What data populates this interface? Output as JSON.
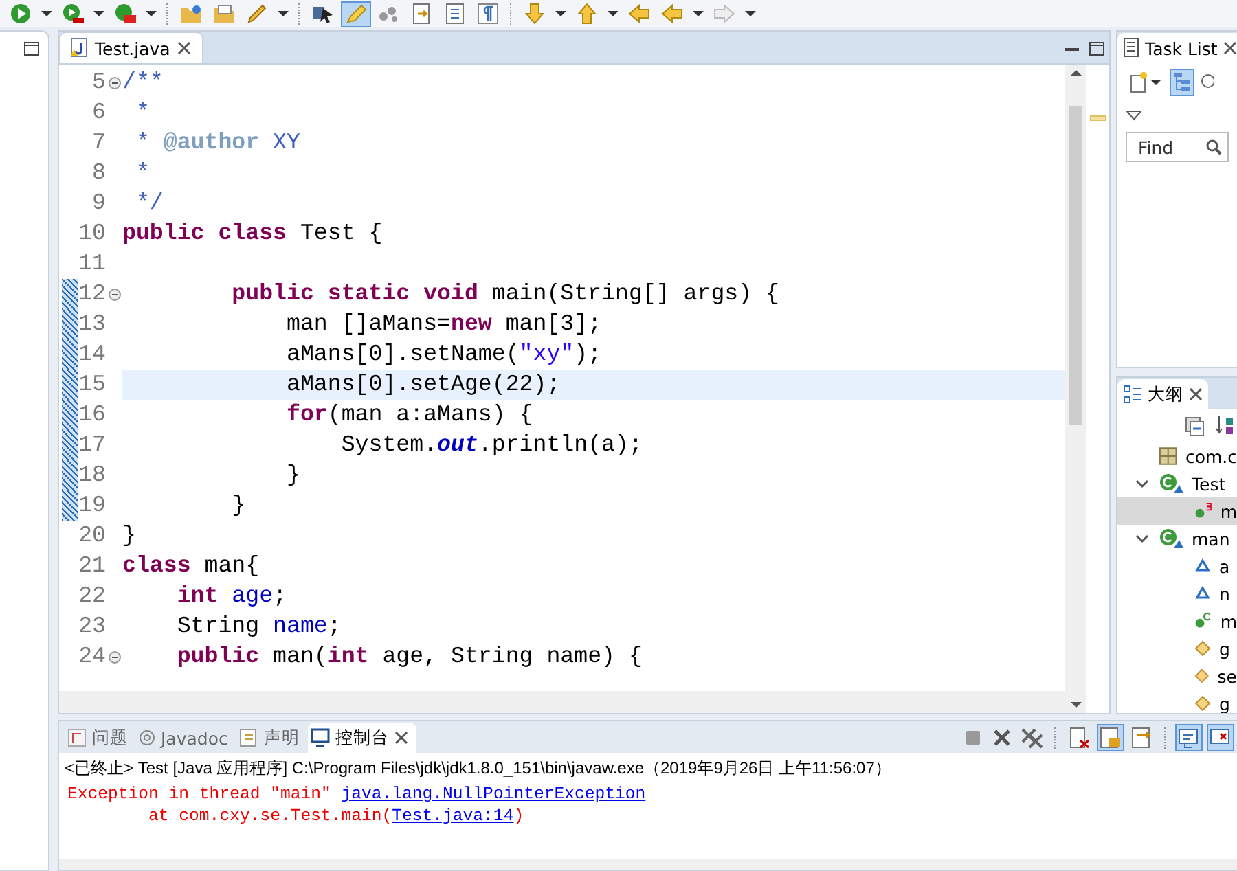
{
  "toolbar": [
    {
      "kind": "run",
      "selected": false
    },
    {
      "kind": "caret",
      "selected": false
    },
    {
      "kind": "debug",
      "selected": false
    },
    {
      "kind": "caret",
      "selected": false
    },
    {
      "kind": "toolbox",
      "selected": false
    },
    {
      "kind": "caret",
      "selected": false
    },
    {
      "kind": "separator"
    },
    {
      "kind": "folder-open",
      "selected": false
    },
    {
      "kind": "folder",
      "selected": false
    },
    {
      "kind": "pen",
      "selected": false
    },
    {
      "kind": "caret",
      "selected": false
    },
    {
      "kind": "separator"
    },
    {
      "kind": "cursor",
      "selected": false
    },
    {
      "kind": "highlighter",
      "selected": true
    },
    {
      "kind": "dots",
      "selected": false
    },
    {
      "kind": "doc-arrow",
      "selected": false
    },
    {
      "kind": "doc-list",
      "selected": false
    },
    {
      "kind": "pilcrow",
      "selected": false
    },
    {
      "kind": "separator"
    },
    {
      "kind": "down",
      "selected": false
    },
    {
      "kind": "caret",
      "selected": false
    },
    {
      "kind": "up",
      "selected": false
    },
    {
      "kind": "caret",
      "selected": false
    },
    {
      "kind": "back",
      "selected": false
    },
    {
      "kind": "left",
      "selected": false
    },
    {
      "kind": "caret",
      "selected": false
    },
    {
      "kind": "right",
      "selected": false
    },
    {
      "kind": "caret",
      "selected": false
    }
  ],
  "editor": {
    "tab": {
      "title": "Test.java"
    },
    "lines": [
      {
        "number": "5",
        "fold": true,
        "changed": false,
        "current": false,
        "tokens": [
          {
            "kind": "comment",
            "text": "/**"
          }
        ]
      },
      {
        "number": "6",
        "fold": false,
        "changed": false,
        "current": false,
        "tokens": [
          {
            "kind": "comment",
            "text": " *"
          }
        ]
      },
      {
        "number": "7",
        "fold": false,
        "changed": false,
        "current": false,
        "tokens": [
          {
            "kind": "comment",
            "text": " * "
          },
          {
            "kind": "tag",
            "text": "@author"
          },
          {
            "kind": "comment",
            "text": " XY"
          }
        ]
      },
      {
        "number": "8",
        "fold": false,
        "changed": false,
        "current": false,
        "tokens": [
          {
            "kind": "comment",
            "text": " *"
          }
        ]
      },
      {
        "number": "9",
        "fold": false,
        "changed": false,
        "current": false,
        "tokens": [
          {
            "kind": "comment",
            "text": " */"
          }
        ]
      },
      {
        "number": "10",
        "fold": false,
        "changed": false,
        "current": false,
        "tokens": [
          {
            "kind": "keyword",
            "text": "public class"
          },
          {
            "kind": "plain",
            "text": " Test {"
          }
        ]
      },
      {
        "number": "11",
        "fold": false,
        "changed": false,
        "current": false
      },
      {
        "number": "12",
        "fold": true,
        "changed": true,
        "current": false,
        "tokens": [
          {
            "kind": "keyword",
            "text": "        public static void"
          },
          {
            "kind": "plain",
            "text": " main(String[] args) {"
          }
        ]
      },
      {
        "number": "13",
        "fold": false,
        "changed": true,
        "current": false,
        "tokens": [
          {
            "kind": "plain",
            "text": "            man []aMans="
          },
          {
            "kind": "keyword",
            "text": "new"
          },
          {
            "kind": "plain",
            "text": " man[3];"
          }
        ]
      },
      {
        "number": "14",
        "fold": false,
        "changed": true,
        "current": false,
        "tokens": [
          {
            "kind": "plain",
            "text": "            aMans[0].setName("
          },
          {
            "kind": "string",
            "text": "\"xy\""
          },
          {
            "kind": "plain",
            "text": ");"
          }
        ]
      },
      {
        "number": "15",
        "fold": false,
        "changed": true,
        "current": true,
        "tokens": [
          {
            "kind": "plain",
            "text": "            aMans[0].setAge(22);"
          }
        ]
      },
      {
        "number": "16",
        "fold": false,
        "changed": true,
        "current": false,
        "tokens": [
          {
            "kind": "keyword",
            "text": "            for"
          },
          {
            "kind": "plain",
            "text": "(man a:aMans) {"
          }
        ]
      },
      {
        "number": "17",
        "fold": false,
        "changed": true,
        "current": false,
        "tokens": [
          {
            "kind": "plain",
            "text": "                System."
          },
          {
            "kind": "static",
            "text": "out"
          },
          {
            "kind": "plain",
            "text": ".println(a);"
          }
        ]
      },
      {
        "number": "18",
        "fold": false,
        "changed": true,
        "current": false,
        "tokens": [
          {
            "kind": "plain",
            "text": "            }"
          }
        ]
      },
      {
        "number": "19",
        "fold": false,
        "changed": true,
        "current": false,
        "tokens": [
          {
            "kind": "plain",
            "text": "        }"
          }
        ]
      },
      {
        "number": "20",
        "fold": false,
        "changed": false,
        "current": false,
        "tokens": [
          {
            "kind": "plain",
            "text": "}"
          }
        ]
      },
      {
        "number": "21",
        "fold": false,
        "changed": false,
        "current": false,
        "tokens": [
          {
            "kind": "keyword",
            "text": "class"
          },
          {
            "kind": "plain",
            "text": " man{"
          }
        ]
      },
      {
        "number": "22",
        "fold": false,
        "changed": false,
        "current": false,
        "tokens": [
          {
            "kind": "keyword",
            "text": "    int"
          },
          {
            "kind": "field",
            "text": " age"
          },
          {
            "kind": "plain",
            "text": ";"
          }
        ]
      },
      {
        "number": "23",
        "fold": false,
        "changed": false,
        "current": false,
        "tokens": [
          {
            "kind": "plain",
            "text": "    String "
          },
          {
            "kind": "field",
            "text": "name"
          },
          {
            "kind": "plain",
            "text": ";"
          }
        ]
      },
      {
        "number": "24",
        "fold": true,
        "changed": false,
        "current": false,
        "tokens": [
          {
            "kind": "keyword",
            "text": "    public"
          },
          {
            "kind": "plain",
            "text": " man("
          },
          {
            "kind": "keyword",
            "text": "int"
          },
          {
            "kind": "plain",
            "text": " age, String name) {"
          }
        ]
      }
    ]
  },
  "task_list": {
    "title": "Task List",
    "search": {
      "placeholder": "Find"
    }
  },
  "outline": {
    "title": "大纲",
    "items": [
      {
        "label": "com.c",
        "kind": "imports",
        "selected": false
      },
      {
        "label": "Test",
        "kind": "class",
        "selected": false,
        "expanded": true,
        "children": [
          {
            "label": "m",
            "kind": "static-method",
            "selected": true
          }
        ]
      },
      {
        "label": "man",
        "kind": "class",
        "selected": false,
        "expanded": true,
        "children": [
          {
            "label": "a",
            "kind": "field",
            "selected": false
          },
          {
            "label": "n",
            "kind": "field",
            "selected": false
          },
          {
            "label": "m",
            "kind": "constructor",
            "selected": false
          },
          {
            "label": "g",
            "kind": "method",
            "selected": false
          },
          {
            "label": "se",
            "kind": "method",
            "selected": false
          },
          {
            "label": "g",
            "kind": "method",
            "selected": false
          }
        ]
      }
    ]
  },
  "console": {
    "tabs": [
      {
        "label": "问题",
        "kind": "problems",
        "selected": false
      },
      {
        "label": "Javadoc",
        "kind": "javadoc",
        "selected": false
      },
      {
        "label": "声明",
        "kind": "declaration",
        "selected": false
      },
      {
        "label": "控制台",
        "kind": "console",
        "selected": true
      }
    ],
    "toolbar": [
      {
        "kind": "stop",
        "selected": false
      },
      {
        "kind": "remove",
        "selected": false
      },
      {
        "kind": "remove-all",
        "selected": false
      },
      {
        "kind": "separator"
      },
      {
        "kind": "clear",
        "selected": false
      },
      {
        "kind": "scroll-lock",
        "selected": true
      },
      {
        "kind": "word-wrap",
        "selected": false
      },
      {
        "kind": "separator"
      },
      {
        "kind": "pin",
        "selected": true
      },
      {
        "kind": "display",
        "selected": true
      }
    ],
    "header": "<已终止> Test [Java 应用程序] C:\\Program Files\\jdk\\jdk1.8.0_151\\bin\\javaw.exe（2019年9月26日 上午11:56:07）",
    "output": [
      [
        {
          "kind": "text",
          "text": "Exception in thread \"main\" "
        },
        {
          "kind": "link",
          "text": "java.lang.NullPointerException"
        }
      ],
      [
        {
          "kind": "text",
          "text": "        at com.cxy.se.Test.main("
        },
        {
          "kind": "link",
          "text": "Test.java:14"
        },
        {
          "kind": "text",
          "text": ")"
        }
      ]
    ]
  }
}
